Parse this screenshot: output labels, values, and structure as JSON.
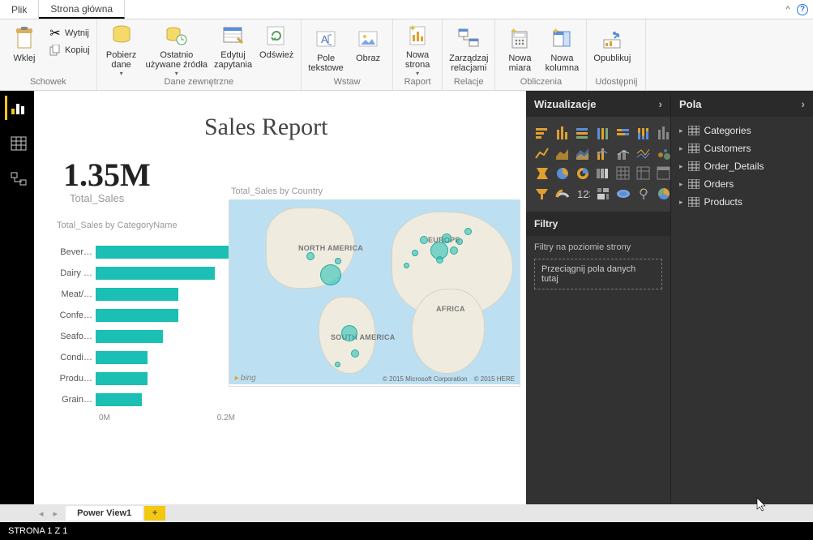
{
  "titlebar": {
    "tabs": [
      "Plik",
      "Strona główna"
    ],
    "active_tab_index": 1
  },
  "ribbon": {
    "groups": {
      "clipboard": {
        "label": "Schowek",
        "paste": "Wklej",
        "cut": "Wytnij",
        "copy": "Kopiuj"
      },
      "external": {
        "label": "Dane zewnętrzne",
        "get_data": "Pobierz\ndane",
        "recent": "Ostatnio\nużywane źródła",
        "edit_queries": "Edytuj\nzapytania",
        "refresh": "Odśwież"
      },
      "insert": {
        "label": "Wstaw",
        "textbox": "Pole\ntekstowe",
        "image": "Obraz"
      },
      "report": {
        "label": "Raport",
        "new_page": "Nowa\nstrona"
      },
      "relations": {
        "label": "Relacje",
        "manage": "Zarządzaj\nrelacjami"
      },
      "calc": {
        "label": "Obliczenia",
        "new_measure": "Nowa\nmiara",
        "new_column": "Nowa\nkolumna"
      },
      "share": {
        "label": "Udostępnij",
        "publish": "Opublikuj"
      }
    }
  },
  "report": {
    "title": "Sales Report",
    "kpi_value": "1.35M",
    "kpi_label": "Total_Sales",
    "bar_title": "Total_Sales by CategoryName",
    "map_title": "Total_Sales by Country",
    "map_attrib1": "© 2015 Microsoft Corporation",
    "map_attrib2": "© 2015 HERE",
    "map_bing": "bing",
    "map_labels": {
      "na": "NORTH\nAMERICA",
      "sa": "SOUTH\nAMERICA",
      "eu": "EUROPE",
      "af": "AFRICA"
    },
    "xaxis_ticks": [
      "0M",
      "0.2M"
    ]
  },
  "chart_data": {
    "type": "bar",
    "title": "Total_Sales by CategoryName",
    "xlabel": "",
    "ylabel": "",
    "xlim": [
      0,
      0.27
    ],
    "categories": [
      "Bever…",
      "Dairy …",
      "Meat/…",
      "Confe…",
      "Seafo…",
      "Condi…",
      "Produ…",
      "Grain…"
    ],
    "values": [
      0.27,
      0.23,
      0.16,
      0.16,
      0.13,
      0.1,
      0.1,
      0.09
    ],
    "unit": "M"
  },
  "panes": {
    "viz": "Wizualizacje",
    "fields": "Pola",
    "filters": "Filtry",
    "page_filters": "Filtry na poziomie strony",
    "drop_hint": "Przeciągnij pola danych tutaj"
  },
  "field_tables": [
    "Categories",
    "Customers",
    "Order_Details",
    "Orders",
    "Products"
  ],
  "pagestrip": {
    "tab": "Power View1"
  },
  "status": {
    "page": "STRONA 1 Z 1"
  }
}
